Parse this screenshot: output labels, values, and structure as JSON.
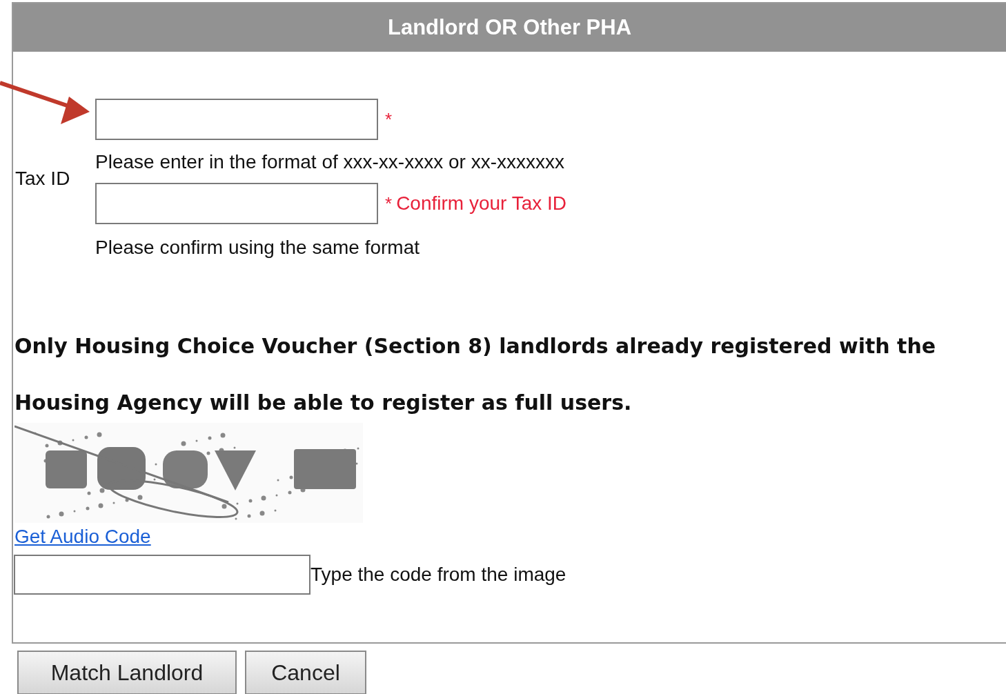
{
  "panel": {
    "title": "Landlord OR Other PHA"
  },
  "tax_id": {
    "label": "Tax ID",
    "fields": [
      {
        "required_mark": "*",
        "hint": "Please enter in the format of xxx-xx-xxxx or xx-xxxxxxx"
      },
      {
        "required_mark": "*",
        "message": "Confirm your Tax ID",
        "hint": "Please confirm using the same format"
      }
    ]
  },
  "notice": "Only Housing Choice Voucher (Section 8) landlords already registered with the Housing Agency will be able to register as full users.",
  "captcha": {
    "kind": "picture",
    "audio_link": "Get Audio Code",
    "instruction": "Type the code from the image"
  },
  "buttons": [
    "Match Landlord",
    "Cancel"
  ]
}
